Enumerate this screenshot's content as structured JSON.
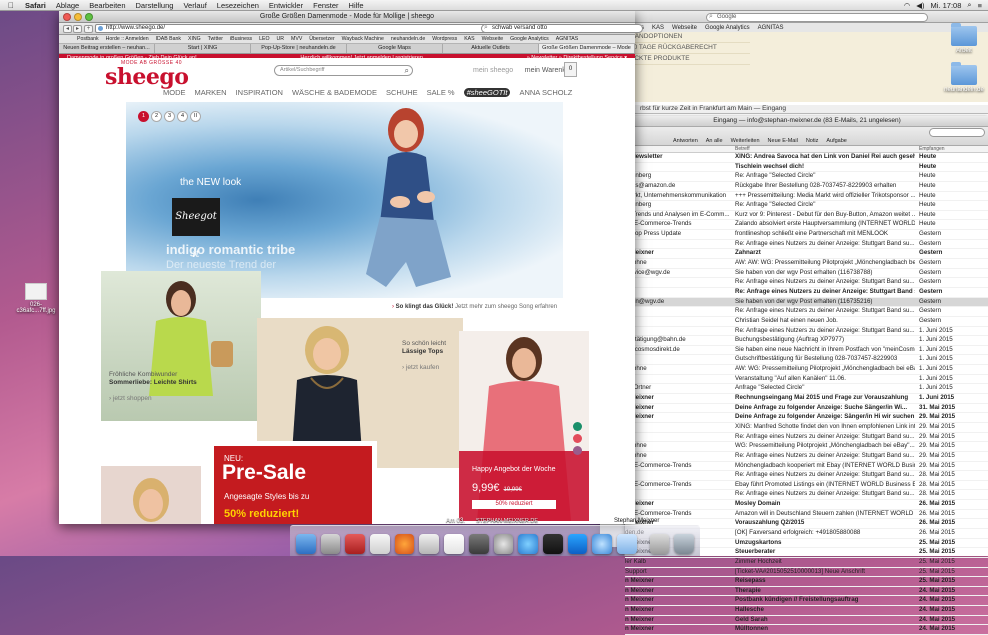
{
  "menubar": {
    "apple": "",
    "items": [
      "Safari",
      "Ablage",
      "Bearbeiten",
      "Darstellung",
      "Verlauf",
      "Lesezeichen",
      "Entwickler",
      "Fenster",
      "Hilfe"
    ],
    "clock": "Mi. 17:08"
  },
  "desktop": {
    "icons": [
      {
        "label": "Arbeit"
      },
      {
        "label": "neuhandeln.de"
      }
    ],
    "file_label": "026-c36afc...7ff.jpg"
  },
  "bg_browser": {
    "bookmarks": [
      "rdpress",
      "KAS",
      "Webseite",
      "Google Analytics",
      "AGNITAS"
    ],
    "search_placeholder": "Google",
    "beige_rows": [
      "RANDOPTIONEN",
      "30 TAGE RÜCKGABERECHT",
      "ACKTE PRODUKTE"
    ],
    "notice": "rbst für kurze Zeit in Frankfurt am Main — Eingang"
  },
  "mail": {
    "title": "Eingang — info@stephan-meixner.de (83 E-Mails, 21 ungelesen)",
    "toolbar": [
      "Antworten",
      "An alle",
      "Weiterleiten",
      "Neue E-Mail",
      "Notiz",
      "Aufgabe"
    ],
    "columns": [
      "Betreff",
      "Empfangen"
    ],
    "rows": [
      {
        "from": "S-Newsletter",
        "subject": "XING: Andrea Savoca hat den Link von Daniel Rei auch gesehe...",
        "date": "Heute",
        "bold": true
      },
      {
        "from": "",
        "subject": "Tischlein wechsel dich!",
        "date": "Heute",
        "bold": true
      },
      {
        "from": "rölenberg",
        "subject": "Re: Anfrage \"Selected Circle\"",
        "date": "Heute",
        "bold": false
      },
      {
        "from": "tatus@amazon.de",
        "subject": "Rückgabe Ihrer Bestellung 028-7037457-8229903 erhalten",
        "date": "Heute",
        "bold": false
      },
      {
        "from": "Markt, Unternehmenskommunikation",
        "subject": "+++ Pressemitteilung: Media Markt wird offizieller Trikotsponsor ...",
        "date": "Heute",
        "bold": false
      },
      {
        "from": "rölenberg",
        "subject": "Re: Anfrage \"Selected Circle\"",
        "date": "Heute",
        "bold": false
      },
      {
        "from": "t - Trends und Analysen im E-Comm...",
        "subject": "Kurz vor 9: Pinterest - Debut für den Buy-Button, Amazon weitet ...",
        "date": "Heute",
        "bold": false
      },
      {
        "from": "ter E-Commerce-Trends",
        "subject": "Zalando absolviert erste Hauptversammlung (INTERNET WORLD B...",
        "date": "Heute",
        "bold": false
      },
      {
        "from": "eshop Press Update",
        "subject": "frontlineshop schließt eine Partnerschaft mit MENLOOK",
        "date": "Gestern",
        "bold": false
      },
      {
        "from": "",
        "subject": "Re: Anfrage eines Nutzers zu deiner Anzeige: Stuttgart Band su...",
        "date": "Gestern",
        "bold": false
      },
      {
        "from": "n Meixner",
        "subject": "Zahnarzt",
        "date": "Gestern",
        "bold": true
      },
      {
        "from": "Daphne",
        "subject": "AW: AW: WG: Pressemitteilung Pilotprojekt „Mönchengladbach bei ...",
        "date": "Gestern",
        "bold": false
      },
      {
        "from": "service@wgv.de",
        "subject": "Sie haben von der wgv Post erhalten (116738788)",
        "date": "Gestern",
        "bold": false
      },
      {
        "from": "",
        "subject": "Re: Anfrage eines Nutzers zu deiner Anzeige: Stuttgart Band su...",
        "date": "Gestern",
        "bold": false
      },
      {
        "from": "",
        "subject": "Re: Anfrage eines Nutzers zu deiner Anzeige: Stuttgart Band su...",
        "date": "Gestern",
        "bold": true
      },
      {
        "from": "aden@wgv.de",
        "subject": "Sie haben von der wgv Post erhalten (116735216)",
        "date": "Gestern",
        "bold": false,
        "sel": true
      },
      {
        "from": "",
        "subject": "Re: Anfrage eines Nutzers zu deiner Anzeige: Stuttgart Band su...",
        "date": "Gestern",
        "bold": false
      },
      {
        "from": "",
        "subject": "Christian Seidel hat einen neuen Job.",
        "date": "Gestern",
        "bold": false
      },
      {
        "from": "",
        "subject": "Re: Anfrage eines Nutzers zu deiner Anzeige: Stuttgart Band su...",
        "date": "1. Juni 2015",
        "bold": false
      },
      {
        "from": "bestätigung@bahn.de",
        "subject": "Buchungsbestätigung (Auftrag XP7977)",
        "date": "1. Juni 2015",
        "bold": false
      },
      {
        "from": "o@cosmosdirekt.de",
        "subject": "Sie haben eine neue Nachricht in Ihrem Postfach von \"meinCosmo...",
        "date": "1. Juni 2015",
        "bold": false
      },
      {
        "from": "e",
        "subject": "Gutschriftbestätigung für Bestellung 028-7037457-8229903",
        "date": "1. Juni 2015",
        "bold": false
      },
      {
        "from": "Daphne",
        "subject": "AW: WG: Pressemitteilung Pilotprojekt „Mönchengladbach bei eBay...",
        "date": "1. Juni 2015",
        "bold": false
      },
      {
        "from": "",
        "subject": "Veranstaltung \"Auf allen Kanälen\" 11.06.",
        "date": "1. Juni 2015",
        "bold": false
      },
      {
        "from": "ler Ortner",
        "subject": "Anfrage \"Selected Circle\"",
        "date": "1. Juni 2015",
        "bold": false
      },
      {
        "from": "n Meixner",
        "subject": "Rechnungseingang Mai 2015 und Frage zur Vorauszahlung",
        "date": "1. Juni 2015",
        "bold": true
      },
      {
        "from": "n Meixner",
        "subject": "Deine Anfrage zu folgender Anzeige: Suche Sänger/in Wi...",
        "date": "31. Mai 2015",
        "bold": true
      },
      {
        "from": "n Meixner",
        "subject": "Deine Anfrage zu folgender Anzeige: Sänger/in Hi wir suchen ...",
        "date": "29. Mai 2015",
        "bold": true
      },
      {
        "from": "",
        "subject": "XING: Manfred Schotte findet den von Ihnen empfohlenen Link int...",
        "date": "29. Mai 2015",
        "bold": false
      },
      {
        "from": "",
        "subject": "Re: Anfrage eines Nutzers zu deiner Anzeige: Stuttgart Band su...",
        "date": "29. Mai 2015",
        "bold": false
      },
      {
        "from": "Daphne",
        "subject": "WG: Pressemitteilung Pilotprojekt „Mönchengladbach bei eBay\"...",
        "date": "29. Mai 2015",
        "bold": false
      },
      {
        "from": "Daphne",
        "subject": "Re: Anfrage eines Nutzers zu deiner Anzeige: Stuttgart Band su...",
        "date": "29. Mai 2015",
        "bold": false
      },
      {
        "from": "ter E-Commerce-Trends",
        "subject": "Mönchengladbach kooperiert mit Ebay (INTERNET WORLD Business...",
        "date": "29. Mai 2015",
        "bold": false
      },
      {
        "from": "",
        "subject": "Re: Anfrage eines Nutzers zu deiner Anzeige: Stuttgart Band su...",
        "date": "28. Mai 2015",
        "bold": false
      },
      {
        "from": "ter E-Commerce-Trends",
        "subject": "Ebay führt Promoted Listings ein (INTERNET WORLD Business E-...",
        "date": "28. Mai 2015",
        "bold": false
      },
      {
        "from": "",
        "subject": "Re: Anfrage eines Nutzers zu deiner Anzeige: Stuttgart Band su...",
        "date": "28. Mai 2015",
        "bold": false
      },
      {
        "from": "n Meixner",
        "subject": "Mosley Domain",
        "date": "26. Mai 2015",
        "bold": true
      },
      {
        "from": "ter E-Commerce-Trends",
        "subject": "Amazon will in Deutschland Steuern zahlen (INTERNET WORLD Bu...",
        "date": "26. Mai 2015",
        "bold": false
      },
      {
        "from": "n Meixner",
        "subject": "Vorauszahlung Q2/2015",
        "date": "26. Mai 2015",
        "bold": true
      },
      {
        "from": "den.de",
        "subject": "[OK] Faxversand erfolgreich: +491805880088",
        "date": "26. Mai 2015",
        "bold": false
      },
      {
        "from": "n Meixner",
        "subject": "Umzugskartons",
        "date": "25. Mai 2015",
        "bold": true
      },
      {
        "from": "n Meixner",
        "subject": "Steuerberater",
        "date": "25. Mai 2015",
        "bold": true
      },
      {
        "from": "ler Kalb",
        "subject": "Zimmer Hochzeit",
        "date": "25. Mai 2015",
        "bold": false
      },
      {
        "from": "Support",
        "subject": "[Ticket-VA#2015052510000013] Neue Anschrift",
        "date": "25. Mai 2015",
        "bold": false
      },
      {
        "from": "n Meixner",
        "subject": "Reisepass",
        "date": "25. Mai 2015",
        "bold": true
      },
      {
        "from": "n Meixner",
        "subject": "Therapie",
        "date": "24. Mai 2015",
        "bold": true
      },
      {
        "from": "n Meixner",
        "subject": "Postbank kündigen // Freistellungsauftrag",
        "date": "24. Mai 2015",
        "bold": true
      },
      {
        "from": "n Meixner",
        "subject": "Hallesche",
        "date": "24. Mai 2015",
        "bold": true
      },
      {
        "from": "n Meixner",
        "subject": "Geld Sarah",
        "date": "24. Mai 2015",
        "bold": true
      },
      {
        "from": "n Meixner",
        "subject": "Mülltonnen",
        "date": "24. Mai 2015",
        "bold": true
      }
    ]
  },
  "safari": {
    "title": "Große Größen Damenmode - Mode für Mollige | sheego",
    "url": "http://www.sheego.de/",
    "search_value": "schwab versand otto",
    "bookmarks": [
      "Postbank",
      "Horde :: Anmelden",
      "IDAB Bank",
      "XING",
      "Twitter",
      "iBusiness",
      "LEO",
      "UR",
      "MVV",
      "Übersetzer",
      "Wayback Machine",
      "neuhandeln.de",
      "Wordpress",
      "KAS",
      "Webseite",
      "Google Analytics",
      "AGNITAS"
    ],
    "tabs": [
      "Neuen Beitrag erstellen – neuhan...",
      "Start | XING",
      "Pop-Up-Store | neuhandeln.de",
      "Google Maps",
      "Aktuelle Outlets",
      "Große Größen Damenmode – Mode"
    ],
    "redbar": [
      "Damenmode in großen Größen - Zieh Dein Glück an!",
      "Herzlich willkommen! Jetzt anmelden | registrieren",
      "» Newsletter  » Direktbestellung  Service ▾"
    ]
  },
  "sheego": {
    "logo": "sheego",
    "logo_tag": "MODE AB GRÖSSE 40",
    "search_placeholder": "Artikel/Suchbegriff",
    "my_account": "mein sheego",
    "cart_label": "mein Warenkorb",
    "cart_count": "0",
    "nav": [
      "MODE",
      "MARKEN",
      "INSPIRATION",
      "WÄSCHE & BADEMODE",
      "SCHUHE",
      "SALE %",
      "#sheeGOTIt",
      "ANNA SCHOLZ"
    ],
    "slider_dots": [
      "1",
      "2",
      "3",
      "4",
      "II"
    ],
    "hero_new_look": "the NEW look",
    "hero_got_it": "Sheegot it",
    "hero_tribe": "indigo romantic tribe",
    "hero_trend": "Der neueste Trend der",
    "hero_caption_bold": "So klingt das Glück!",
    "hero_caption": "Jetzt mehr zum sheego Song erfahren",
    "tile1_text": "Fröhliche Kombiwunder",
    "tile1_bold": "Sommerliebe: Leichte Shirts",
    "tile1_link": "jetzt shoppen",
    "tile2_text": "So schön leicht",
    "tile2_bold": "Lässige Tops",
    "tile2_link": "jetzt kaufen",
    "presale_neu": "NEU:",
    "presale_big": "Pre-Sale",
    "presale_sub": "Angesagte Styles bis zu",
    "presale_sub2": "50% reduziert!",
    "angebot": "Happy Angebot der Woche",
    "price_new": "9,99€",
    "price_old": "19,99€",
    "reduced": "50% reduziert",
    "swatch_colors": [
      "#1a8f6a",
      "#e34c5b",
      "#9a5c8c"
    ]
  },
  "status": {
    "bottom_left": "Am 03.",
    "bottom_mid": "STEPHAN-MEIXNER.DE",
    "bottom_right": "Stephan Meixner"
  },
  "colors": {
    "sheego_red": "#c8102e"
  }
}
